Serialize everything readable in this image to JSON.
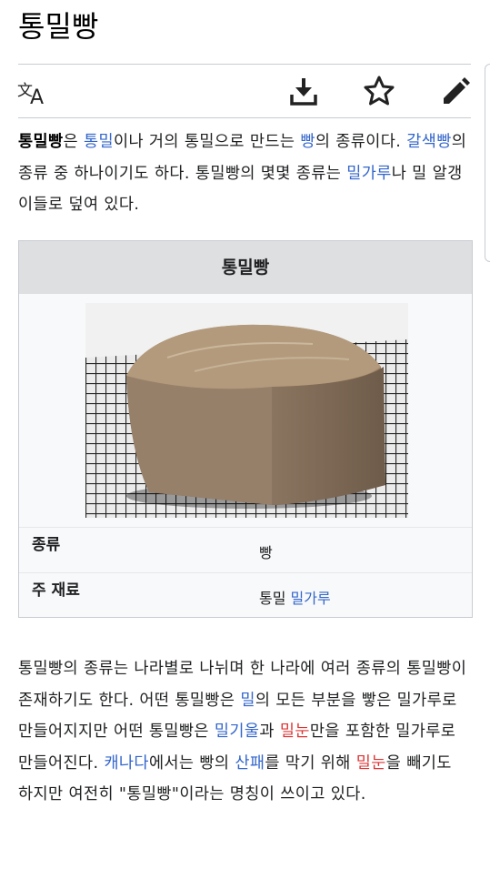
{
  "page": {
    "title": "통밀빵"
  },
  "toolbar": {
    "language_icon": "translate-icon",
    "download_icon": "download-icon",
    "watch_icon": "star-icon",
    "edit_icon": "pencil-icon"
  },
  "lead": {
    "bold_term": "통밀빵",
    "t1": "은 ",
    "link_wholewheat": "통밀",
    "t2": "이나 거의 통밀으로 만드는 ",
    "link_bread": "빵",
    "t3": "의 종류이다. ",
    "link_brownbread": "갈색빵",
    "t4": "의 종류 중 하나이기도 하다. 통밀빵의 몇몇 종류는 ",
    "link_flour": "밀가루",
    "t5": "나 밀 알갱이들로 덮여 있다."
  },
  "infobox": {
    "title": "통밀빵",
    "image_subject": "whole-wheat bread loaf on cooling rack",
    "rows": [
      {
        "key": "종류",
        "value": "빵"
      },
      {
        "key": "주 재료",
        "value": "통밀",
        "value_link": "밀가루"
      }
    ]
  },
  "body": {
    "t1": "통밀빵의 종류는 나라별로 나뉘며 한 나라에 여러 종류의 통밀빵이 존재하기도 한다. 어떤 통밀빵은 ",
    "link_wheat": "밀",
    "t2": "의 모든 부분을 빻은 밀가루로 만들어지지만 어떤 통밀빵은 ",
    "link_bran": "밀기울",
    "t3": "과 ",
    "link_germ": "밀눈",
    "t4": "만을 포함한 밀가루로 만들어진다. ",
    "link_canada": "캐나다",
    "t5": "에서는 빵의 ",
    "link_rancid": "산패",
    "t6": "를 막기 위해 ",
    "link_germ2": "밀눈",
    "t7": "을 빼기도 하지만 여전히 \"통밀빵\"이라는 명칭이 쓰이고 있다."
  },
  "colors": {
    "link": "#3366cc",
    "missing_link": "#dd3333",
    "text": "#202122",
    "infobox_header": "#dedfe0"
  }
}
